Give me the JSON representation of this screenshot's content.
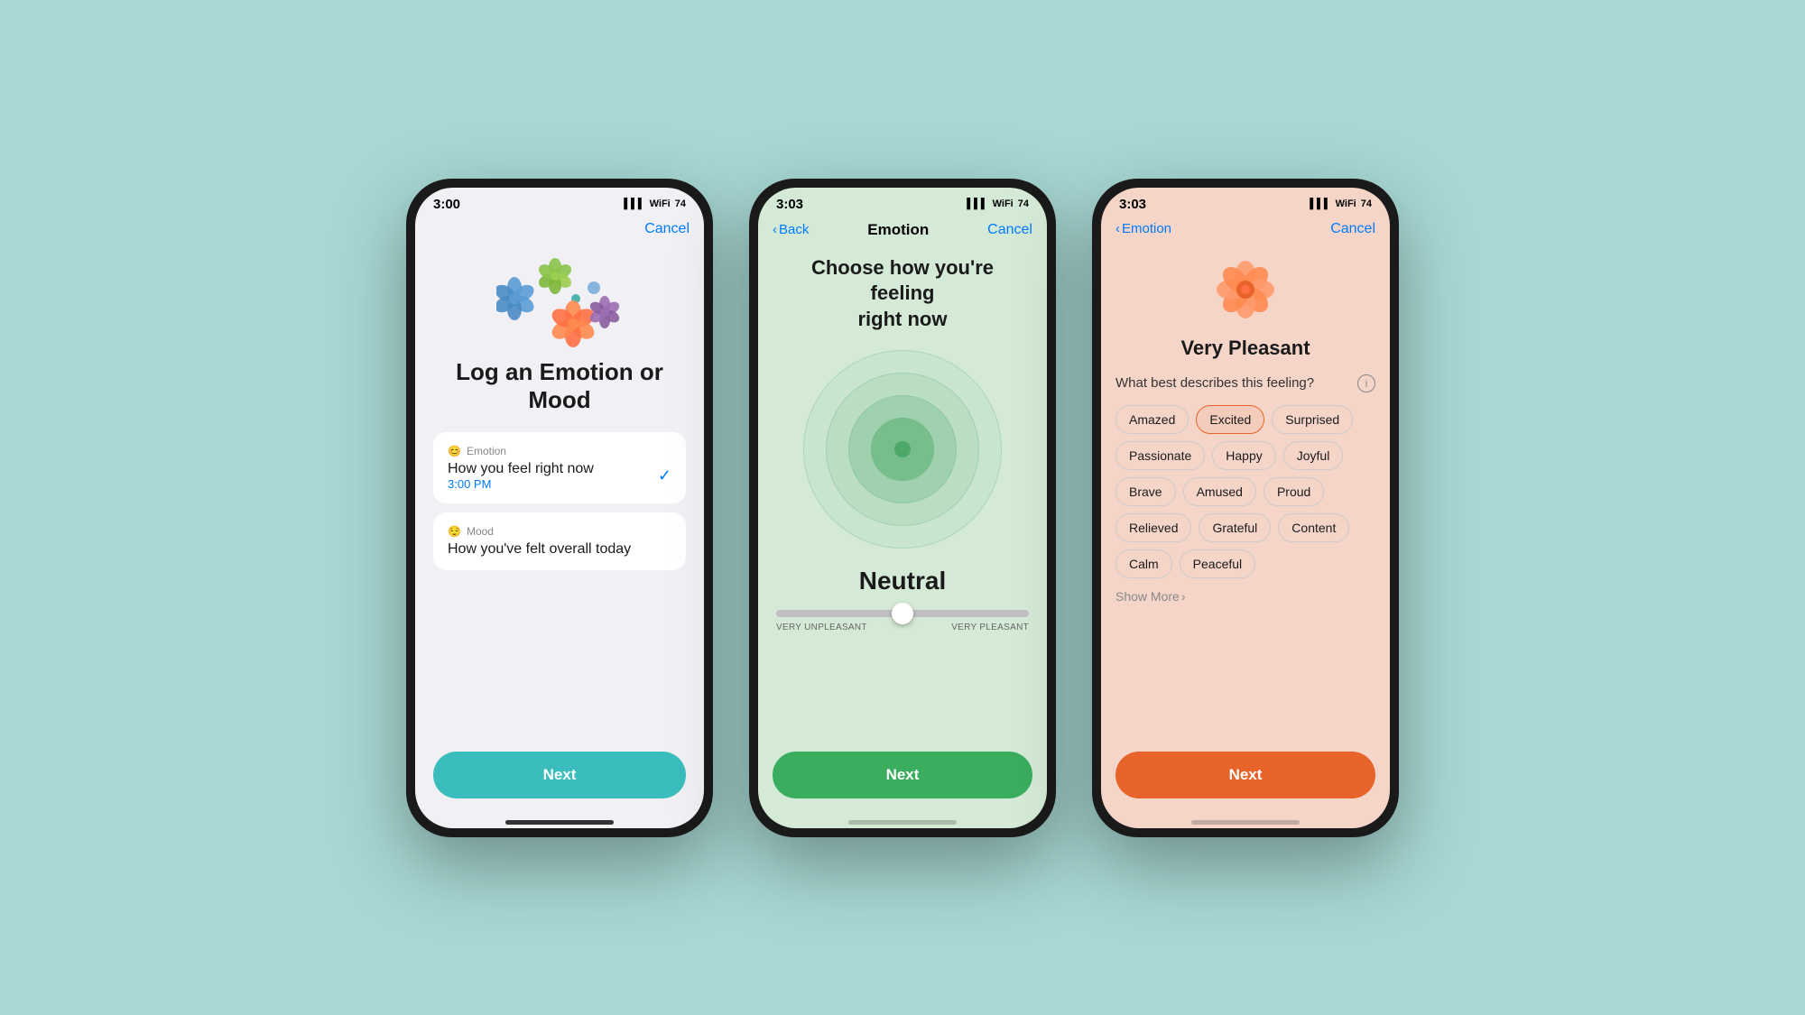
{
  "background": "#a8d8d4",
  "phones": [
    {
      "id": "phone1",
      "status": {
        "time": "3:00",
        "arrow": "↗",
        "battery": "74"
      },
      "nav": {
        "cancel": "Cancel"
      },
      "title": "Log an Emotion\nor Mood",
      "options": [
        {
          "icon": "emotion-icon",
          "label": "Emotion",
          "description": "How you feel right now",
          "time": "3:00 PM",
          "checked": true
        },
        {
          "icon": "mood-icon",
          "label": "Mood",
          "description": "How you've felt overall today",
          "time": null,
          "checked": false
        }
      ],
      "next_label": "Next",
      "btn_class": "btn-teal"
    },
    {
      "id": "phone2",
      "status": {
        "time": "3:03",
        "arrow": "↗",
        "battery": "74"
      },
      "nav": {
        "back": "Back",
        "title": "Emotion",
        "cancel": "Cancel"
      },
      "emotion_title": "Choose how you're feeling\nright now",
      "emotion_value": "Neutral",
      "slider": {
        "min_label": "VERY UNPLEASANT",
        "max_label": "VERY PLEASANT",
        "position": 50
      },
      "next_label": "Next",
      "btn_class": "btn-green"
    },
    {
      "id": "phone3",
      "status": {
        "time": "3:03",
        "arrow": "↗",
        "battery": "74"
      },
      "nav": {
        "back": "Emotion",
        "cancel": "Cancel"
      },
      "feeling_label": "Very Pleasant",
      "question": "What best describes this feeling?",
      "tags": [
        {
          "label": "Amazed",
          "selected": false
        },
        {
          "label": "Excited",
          "selected": true
        },
        {
          "label": "Surprised",
          "selected": false
        },
        {
          "label": "Passionate",
          "selected": false
        },
        {
          "label": "Happy",
          "selected": false
        },
        {
          "label": "Joyful",
          "selected": false
        },
        {
          "label": "Brave",
          "selected": false
        },
        {
          "label": "Amused",
          "selected": false
        },
        {
          "label": "Proud",
          "selected": false
        },
        {
          "label": "Relieved",
          "selected": false
        },
        {
          "label": "Grateful",
          "selected": false
        },
        {
          "label": "Content",
          "selected": false
        },
        {
          "label": "Calm",
          "selected": false
        },
        {
          "label": "Peaceful",
          "selected": false
        }
      ],
      "show_more": "Show More",
      "next_label": "Next",
      "btn_class": "btn-orange"
    }
  ]
}
